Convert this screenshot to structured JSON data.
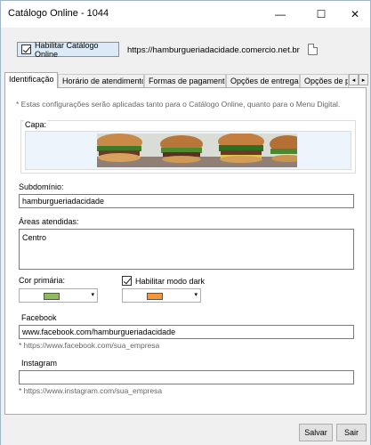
{
  "window": {
    "title": "Catálogo Online - 1044"
  },
  "titlebar": {
    "min_glyph": "—",
    "max_glyph": "☐",
    "close_glyph": "✕"
  },
  "top": {
    "enable_label": "Habilitar Catálogo Online",
    "enable_checked": true,
    "url": "https://hamburgueriadacidade.comercio.net.br"
  },
  "tabs": [
    {
      "label": "Identificação"
    },
    {
      "label": "Horário de atendimento"
    },
    {
      "label": "Formas de pagamento"
    },
    {
      "label": "Opções de entrega"
    },
    {
      "label": "Opções de pe"
    }
  ],
  "tab_scroll": {
    "left": "◂",
    "right": "▸"
  },
  "panel": {
    "note": "* Estas configurações serão aplicadas tanto para o Catálogo Online, quanto para o Menu Digital.",
    "capa_label": "Capa:",
    "subdominio_label": "Subdomínio:",
    "subdominio_value": "hamburgueriadacidade",
    "areas_label": "Áreas atendidas:",
    "areas_value": "Centro",
    "cor_label": "Cor primária:",
    "cor_primaria_color": "#8fbc5a",
    "dark_label": "Habilitar modo dark",
    "dark_checked": true,
    "dark_color": "#f4963a",
    "combo_arrow": "▾",
    "facebook_label": "Facebook",
    "facebook_value": "www.facebook.com/hamburgueriadacidade",
    "facebook_hint": "* https://www.facebook.com/sua_empresa",
    "instagram_label": "Instagram",
    "instagram_value": "",
    "instagram_hint": "* https://www.instagram.com/sua_empresa"
  },
  "buttons": {
    "save": "Salvar",
    "exit": "Sair"
  }
}
